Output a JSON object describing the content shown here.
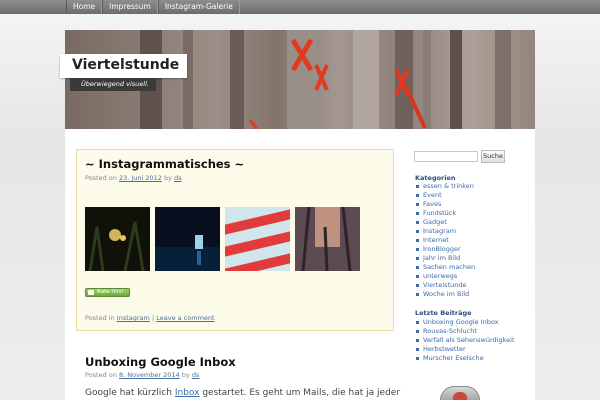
{
  "nav": {
    "items": [
      "Home",
      "Impressum",
      "Instagram-Galerie"
    ]
  },
  "site": {
    "title": "Viertelstunde",
    "tagline": "Überwiegend visuell."
  },
  "posts": [
    {
      "title": "~ Instagrammatisches ~",
      "meta_prefix": "Posted on",
      "date": "23. Juni 2012",
      "meta_by": "by",
      "author": "ds",
      "rate_label": "Rate this!",
      "footer_prefix": "Posted in",
      "category": "Instagram",
      "footer_sep": "|",
      "comment_link": "Leave a comment"
    },
    {
      "title": "Unboxing Google Inbox",
      "meta_prefix": "Posted on",
      "date": "8. November 2014",
      "meta_by": "by",
      "author": "ds",
      "excerpt_start": "Google hat kürzlich",
      "excerpt_link": "Inbox",
      "excerpt_end": "gestartet. Es geht um Mails, die hat ja jeder"
    }
  ],
  "sidebar": {
    "search_button": "Suche",
    "categories_title": "Kategorien",
    "categories": [
      "essen & trinken",
      "Event",
      "Faves",
      "Fundstück",
      "Gadget",
      "Instagram",
      "Internet",
      "IronBlogger",
      "Jahr im Bild",
      "Sachen machen",
      "unterwegs",
      "Viertelstunde",
      "Woche im Bild"
    ],
    "recent_title": "Letzte Beiträge",
    "recent": [
      "Unboxing Google Inbox",
      "Rouvas-Schlucht",
      "Verfall als Sehenswürdigkeit",
      "Herbstwetter",
      "Murscher Eselsche"
    ]
  },
  "colors": {
    "link": "#3a6aa8",
    "post_bg": "#fdfbe9",
    "widget_title": "#2a4e7a"
  }
}
